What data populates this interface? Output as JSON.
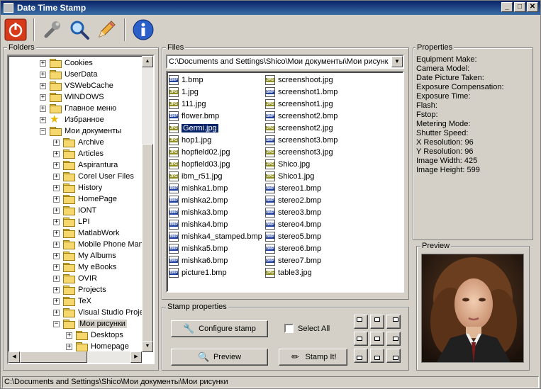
{
  "window": {
    "title": "Date Time Stamp",
    "min": "_",
    "max": "□",
    "close": "✕"
  },
  "toolbar": {
    "icons": [
      "power-icon",
      "wrench-icon",
      "magnifier-icon",
      "pencil-icon",
      "info-icon"
    ]
  },
  "folders": {
    "legend": "Folders",
    "items": [
      {
        "label": "Cookies",
        "level": 2,
        "expander": "+",
        "icon": "folder"
      },
      {
        "label": "UserData",
        "level": 2,
        "expander": "+",
        "icon": "folder"
      },
      {
        "label": "VSWebCache",
        "level": 2,
        "expander": "+",
        "icon": "folder"
      },
      {
        "label": "WINDOWS",
        "level": 2,
        "expander": "+",
        "icon": "folder"
      },
      {
        "label": "Главное меню",
        "level": 2,
        "expander": "+",
        "icon": "folder"
      },
      {
        "label": "Избранное",
        "level": 2,
        "expander": "+",
        "icon": "star"
      },
      {
        "label": "Мои документы",
        "level": 2,
        "expander": "−",
        "icon": "folder"
      },
      {
        "label": "Archive",
        "level": 3,
        "expander": "+",
        "icon": "folder"
      },
      {
        "label": "Articles",
        "level": 3,
        "expander": "+",
        "icon": "folder"
      },
      {
        "label": "Aspirantura",
        "level": 3,
        "expander": "+",
        "icon": "folder"
      },
      {
        "label": "Corel User Files",
        "level": 3,
        "expander": "+",
        "icon": "folder"
      },
      {
        "label": "History",
        "level": 3,
        "expander": "+",
        "icon": "folder"
      },
      {
        "label": "HomePage",
        "level": 3,
        "expander": "+",
        "icon": "folder"
      },
      {
        "label": "IONT",
        "level": 3,
        "expander": "+",
        "icon": "folder"
      },
      {
        "label": "LPI",
        "level": 3,
        "expander": "+",
        "icon": "folder"
      },
      {
        "label": "MatlabWork",
        "level": 3,
        "expander": "+",
        "icon": "folder"
      },
      {
        "label": "Mobile Phone Mana",
        "level": 3,
        "expander": "+",
        "icon": "folder"
      },
      {
        "label": "My Albums",
        "level": 3,
        "expander": "+",
        "icon": "folder"
      },
      {
        "label": "My eBooks",
        "level": 3,
        "expander": "+",
        "icon": "folder"
      },
      {
        "label": "OVIR",
        "level": 3,
        "expander": "+",
        "icon": "folder"
      },
      {
        "label": "Projects",
        "level": 3,
        "expander": "+",
        "icon": "folder"
      },
      {
        "label": "TeX",
        "level": 3,
        "expander": "+",
        "icon": "folder"
      },
      {
        "label": "Visual Studio Projec",
        "level": 3,
        "expander": "+",
        "icon": "folder"
      },
      {
        "label": "Мои рисунки",
        "level": 3,
        "expander": "−",
        "icon": "folder",
        "selected": true
      },
      {
        "label": "Desktops",
        "level": 4,
        "expander": "+",
        "icon": "folder"
      },
      {
        "label": "Homepage",
        "level": 4,
        "expander": "+",
        "icon": "folder"
      }
    ]
  },
  "files": {
    "legend": "Files",
    "path": "C:\\Documents and Settings\\Shico\\Мои документы\\Мои рисунк",
    "col1": [
      {
        "name": "1.bmp",
        "type": "BMP"
      },
      {
        "name": "1.jpg",
        "type": "JPG"
      },
      {
        "name": "111.jpg",
        "type": "JPG"
      },
      {
        "name": "flower.bmp",
        "type": "BMP"
      },
      {
        "name": "Germi.jpg",
        "type": "JPG",
        "selected": true
      },
      {
        "name": "hop1.jpg",
        "type": "JPG"
      },
      {
        "name": "hopfield02.jpg",
        "type": "JPG"
      },
      {
        "name": "hopfield03.jpg",
        "type": "JPG"
      },
      {
        "name": "ibm_r51.jpg",
        "type": "JPG"
      },
      {
        "name": "mishka1.bmp",
        "type": "BMP"
      },
      {
        "name": "mishka2.bmp",
        "type": "BMP"
      },
      {
        "name": "mishka3.bmp",
        "type": "BMP"
      },
      {
        "name": "mishka4.bmp",
        "type": "BMP"
      },
      {
        "name": "mishka4_stamped.bmp",
        "type": "BMP"
      },
      {
        "name": "mishka5.bmp",
        "type": "BMP"
      },
      {
        "name": "mishka6.bmp",
        "type": "BMP"
      },
      {
        "name": "picture1.bmp",
        "type": "BMP"
      }
    ],
    "col2": [
      {
        "name": "screenshoot.jpg",
        "type": "JPG"
      },
      {
        "name": "screenshot1.bmp",
        "type": "BMP"
      },
      {
        "name": "screenshot1.jpg",
        "type": "JPG"
      },
      {
        "name": "screenshot2.bmp",
        "type": "BMP"
      },
      {
        "name": "screenshot2.jpg",
        "type": "JPG"
      },
      {
        "name": "screenshot3.bmp",
        "type": "BMP"
      },
      {
        "name": "screenshot3.jpg",
        "type": "JPG"
      },
      {
        "name": "Shico.jpg",
        "type": "JPG"
      },
      {
        "name": "Shico1.jpg",
        "type": "JPG"
      },
      {
        "name": "stereo1.bmp",
        "type": "BMP"
      },
      {
        "name": "stereo2.bmp",
        "type": "BMP"
      },
      {
        "name": "stereo3.bmp",
        "type": "BMP"
      },
      {
        "name": "stereo4.bmp",
        "type": "BMP"
      },
      {
        "name": "stereo5.bmp",
        "type": "BMP"
      },
      {
        "name": "stereo6.bmp",
        "type": "BMP"
      },
      {
        "name": "stereo7.bmp",
        "type": "BMP"
      },
      {
        "name": "table3.jpg",
        "type": "JPG"
      }
    ]
  },
  "properties": {
    "legend": "Properties",
    "lines": [
      "Equipment Make:",
      "Camera    Model:",
      "Date Picture Taken:",
      "Exposure Compensation:",
      "Exposure Time:",
      "Flash:",
      "Fstop:",
      "Metering Mode:",
      "Shutter Speed:",
      "X Resolution: 96",
      "Y Resolution: 96",
      "Image Width: 425",
      "Image Height: 599"
    ]
  },
  "preview": {
    "legend": "Preview"
  },
  "stamp": {
    "legend": "Stamp properties",
    "configure_label": "Configure stamp",
    "select_all_label": "Select All",
    "preview_label": "Preview",
    "stamp_label": "Stamp It!"
  },
  "status": {
    "text": "C:\\Documents and Settings\\Shico\\Мои документы\\Мои рисунки"
  }
}
